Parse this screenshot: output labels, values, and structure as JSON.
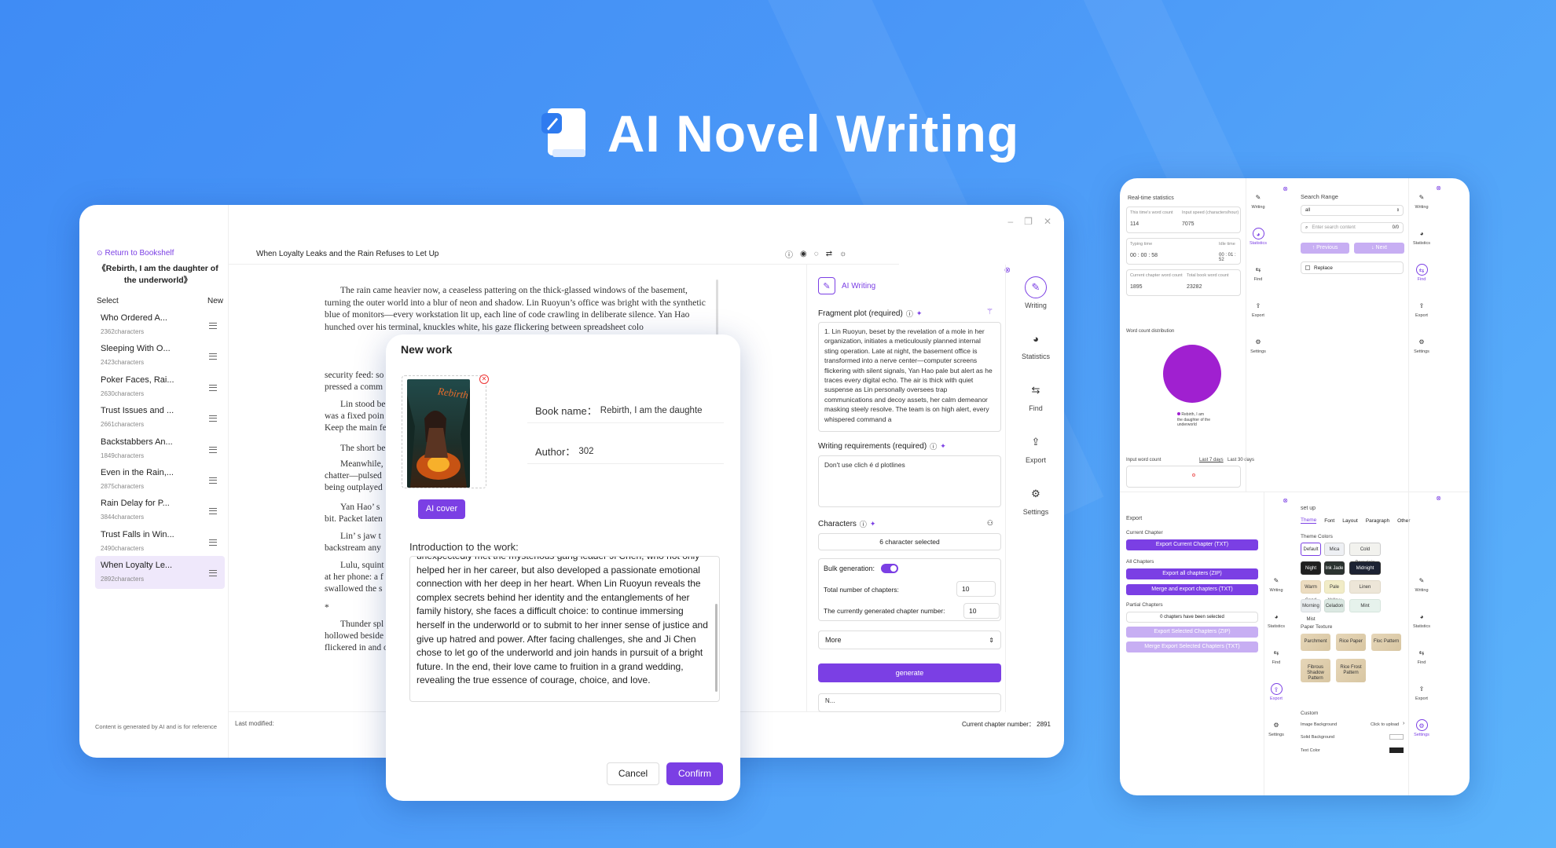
{
  "hero": {
    "title": "AI Novel Writing"
  },
  "main": {
    "return_label": "Return to Bookshelf",
    "book_title_line1": "《Rebirth, I am the daughter of",
    "book_title_line2": "the underworld》",
    "select_label": "Select",
    "new_label": "New",
    "chapters": [
      {
        "name": "Who Ordered A...",
        "count": "2362characters"
      },
      {
        "name": "Sleeping With O...",
        "count": "2423characters"
      },
      {
        "name": "Poker Faces, Rai...",
        "count": "2630characters"
      },
      {
        "name": "Trust Issues and ...",
        "count": "2661characters"
      },
      {
        "name": "Backstabbers An...",
        "count": "1849characters"
      },
      {
        "name": "Even in the Rain,...",
        "count": "2875characters"
      },
      {
        "name": "Rain Delay for P...",
        "count": "3844characters"
      },
      {
        "name": "Trust Falls in Win...",
        "count": "2490characters"
      },
      {
        "name": "When Loyalty Le...",
        "count": "2892characters"
      }
    ],
    "footer_note": "Content is generated by AI and is for reference",
    "chapter_title": "When Loyalty Leaks and the Rain Refuses to Let Up",
    "last_modified": "Last modified:",
    "current_chapter_number": "Current chapter number： 2891",
    "paragraphs": [
      "The rain came heavier now, a ceaseless pattering on the thick-glassed windows of the basement, turning the outer world into a blur of neon and shadow. Lin Ruoyun’s office was bright with the synthetic blue of monitors—every workstation lit up, each line of code crawling in deliberate silence. Yan Hao hunched over his terminal, knuckles white, his gaze flickering between spreadsheet colo",
      "security feed: so",
      "pressed a comm",
      "Lin stood be",
      "was a fixed poin",
      "Keep the main fe",
      "The short be",
      "Meanwhile,",
      "chatter—pulsed",
      "being outplayed",
      "Yan Hao’ s",
      "bit. Packet laten",
      "Lin’ s jaw t",
      "backstream any",
      "Lulu, squint",
      "at her phone: a f",
      "swallowed the s",
      "*",
      "Thunder spl",
      "hollowed beside",
      "flickered in and o"
    ],
    "ai": {
      "title": "AI Writing",
      "fragment_label": "Fragment plot (required)",
      "fragment_text": "1. Lin Ruoyun, beset by the revelation of a mole in her organization, initiates a meticulously planned internal sting operation. Late at night, the basement office is transformed into a nerve center—computer screens flickering with silent signals, Yan Hao pale but alert as he traces every digital echo. The air is thick with quiet suspense as Lin personally oversees trap communications and decoy assets, her calm demeanor masking steely resolve. The team is on high alert, every whispered command a",
      "writing_req_label": "Writing requirements (required)",
      "writing_req_text": "Don't use clich é d plotlines",
      "characters_label": "Characters",
      "characters_value": "6 character selected",
      "bulk_label": "Bulk generation:",
      "total_chapters_label": "Total number of chapters:",
      "total_chapters_value": "10",
      "current_gen_label": "The currently generated chapter number:",
      "current_gen_value": "10",
      "more_label": "More",
      "generate_label": "generate",
      "cut_text": "N..."
    },
    "side": [
      "Writing",
      "Statistics",
      "Find",
      "Export",
      "Settings"
    ]
  },
  "modal": {
    "title": "New work",
    "cover_text": "Rebirth",
    "ai_cover": "AI cover",
    "book_name_label": "Book name：",
    "book_name_value": "Rebirth, I am the daughte",
    "author_label": "Author：",
    "author_value": "302",
    "intro_label": "Introduction to the work:",
    "intro_text": "unexpectedly met the mysterious gang leader Ji Chen, who not only helped her in her career, but also developed a passionate emotional connection with her deep in her heart. When Lin Ruoyun reveals the complex secrets behind her identity and the entanglements of her family history, she faces a difficult choice: to continue immersing herself in the underworld or to submit to her inner sense of justice and give up hatred and power. After facing challenges, she and Ji Chen chose to let go of the underworld and join hands in pursuit of a bright future. In the end, their love came to fruition in a grand wedding, revealing the true essence of courage, choice, and love.",
    "cancel": "Cancel",
    "confirm": "Confirm"
  },
  "right": {
    "stats": {
      "title": "Real-time statistics",
      "word_count_label": "This time's word count",
      "word_count_value": "114",
      "speed_label": "Input speed (characters/hour)",
      "speed_value": "7075",
      "typing_label": "Typing time",
      "typing_value": "00 : 00 : 58",
      "idle_label": "Idle time",
      "idle_value": "00 : 01 : 52",
      "chapter_wc_label": "Current chapter word count",
      "chapter_wc_value": "1895",
      "total_wc_label": "Total book word count",
      "total_wc_value": "23282",
      "distribution_label": "Word count distribution",
      "legend": "Rebirth, I am the daughter of the underworld",
      "input_wc_label": "Input word count",
      "last7": "Last 7 days",
      "last30": "Last 30 days"
    },
    "find": {
      "title": "Search Range",
      "select_value": "all",
      "placeholder": "Enter search content",
      "count": "0/0",
      "previous": "↑ Previous",
      "next": "↓ Next",
      "replace": "Replace"
    },
    "export": {
      "title": "Export",
      "current_chapter": "Current Chapter",
      "export_current": "Export Current Chapter (TXT)",
      "all_chapters": "All Chapters",
      "export_all": "Export all chapters (ZIP)",
      "merge_all": "Merge and export chapters (TXT)",
      "partial": "Partial Chapters",
      "selected": "0 chapters have been selected",
      "export_selected": "Export Selected Chapters (ZIP)",
      "merge_selected": "Merge Export Selected Chapters (TXT)"
    },
    "setup": {
      "title": "set up",
      "tabs": [
        "Theme",
        "Font",
        "Layout",
        "Paragraph",
        "Other"
      ],
      "theme_colors": "Theme Colors",
      "colors_row1": [
        "Default",
        "Mica",
        "Cold Porcelain"
      ],
      "colors_row2": [
        "Night",
        "Ink Jade",
        "Midnight"
      ],
      "colors_row3": [
        "Warm Sand",
        "Pale Yellow",
        "Linen"
      ],
      "colors_row4": [
        "Morning Mist",
        "Celadon",
        "Mint"
      ],
      "paper_texture": "Paper Texture",
      "papers": [
        "Parchment",
        "Rice Paper",
        "Floc Pattern",
        "Fibrous Shadow Pattern",
        "Rice Frost Pattern"
      ],
      "custom": "Custom",
      "image_bg": "Image Background",
      "click_upload": "Click to upload",
      "solid_bg": "Solid Background",
      "text_color": "Text Color"
    },
    "side": [
      "Writing",
      "Statistics",
      "Find",
      "Export",
      "Settings"
    ]
  },
  "colors": {
    "accent": "#7b3fe4",
    "pie": "#a020d0",
    "bg": "#4a97f7"
  }
}
